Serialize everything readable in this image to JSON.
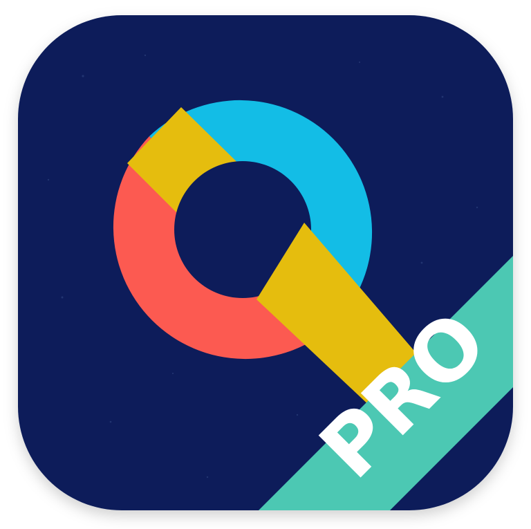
{
  "app_icon": {
    "badge_label": "PRO",
    "colors": {
      "background": "#0c1f5a",
      "cyan_segment": "#13bde6",
      "coral_segment": "#fc5a51",
      "yellow_band": "#e5bd0e",
      "badge_ribbon": "#4cc8b3",
      "badge_text": "#ffffff"
    },
    "icon_name": "search-magnifier-q-icon"
  }
}
